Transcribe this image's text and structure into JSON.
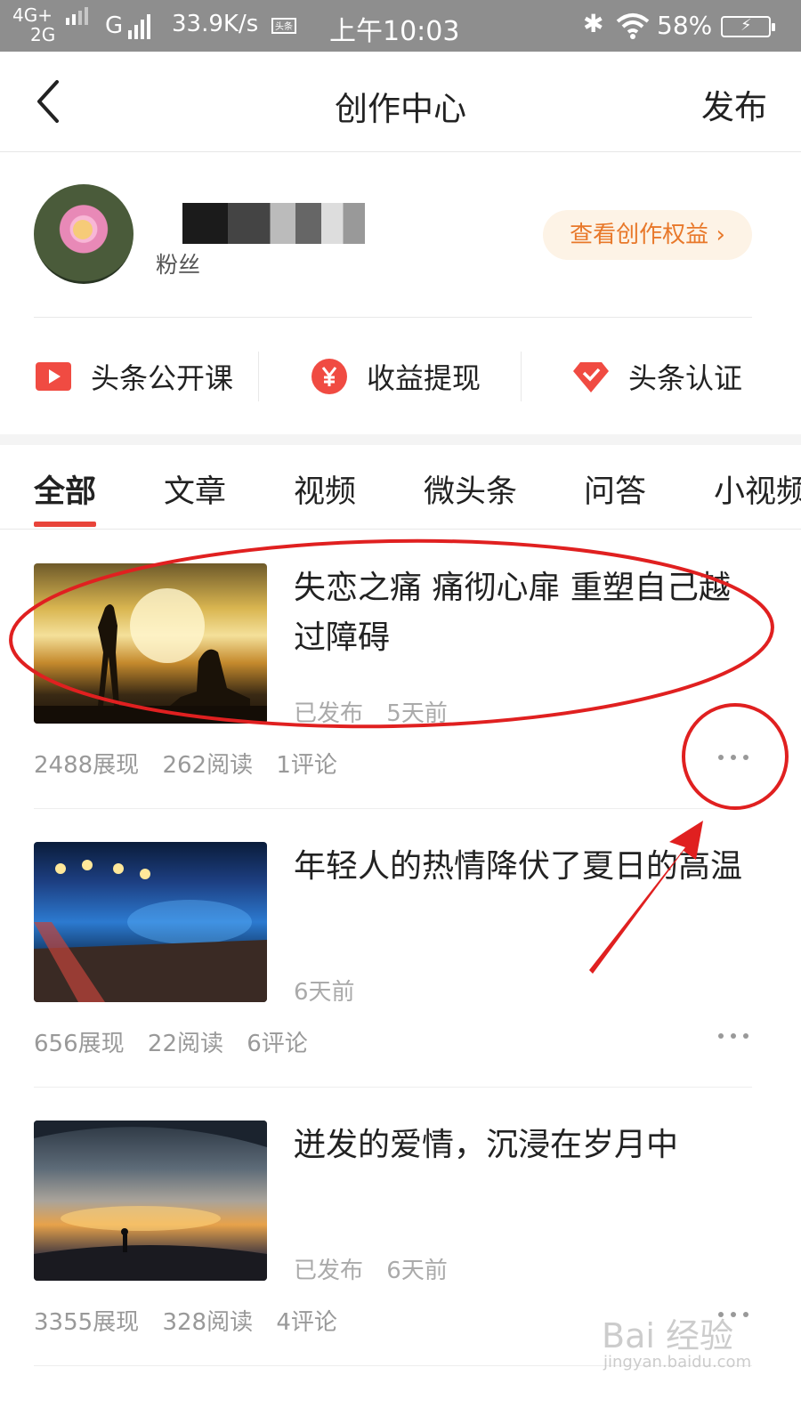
{
  "status_bar": {
    "net_line1": "4G+",
    "net_line2": "2G",
    "g": "G",
    "speed": "33.9K/s",
    "app_badge": "头条",
    "time": "上午10:03",
    "battery": "58%"
  },
  "navbar": {
    "title": "创作中心",
    "publish_label": "发布"
  },
  "profile": {
    "fans_label": "粉丝",
    "benefit_label": "查看创作权益"
  },
  "quick_actions": [
    {
      "label": "头条公开课",
      "icon": "play-video-icon"
    },
    {
      "label": "收益提现",
      "icon": "yen-coin-icon"
    },
    {
      "label": "头条认证",
      "icon": "diamond-check-icon"
    }
  ],
  "tabs": [
    "全部",
    "文章",
    "视频",
    "微头条",
    "问答",
    "小视频"
  ],
  "active_tab": "全部",
  "articles": [
    {
      "title": "失恋之痛 痛彻心扉 重塑自己越过障碍",
      "status": "已发布",
      "time": "5天前",
      "views": "2488展现",
      "reads": "262阅读",
      "comments": "1评论"
    },
    {
      "title": "年轻人的热情降伏了夏日的高温",
      "status": "",
      "time": "6天前",
      "views": "656展现",
      "reads": "22阅读",
      "comments": "6评论"
    },
    {
      "title": "迸发的爱情，沉浸在岁月中",
      "status": "已发布",
      "time": "6天前",
      "views": "3355展现",
      "reads": "328阅读",
      "comments": "4评论"
    }
  ],
  "watermark": {
    "brand": "Bai 经验",
    "url": "jingyan.baidu.com"
  },
  "colors": {
    "accent_red": "#e8443a",
    "benefit_orange": "#e8782a",
    "annotation_red": "#e02020"
  }
}
